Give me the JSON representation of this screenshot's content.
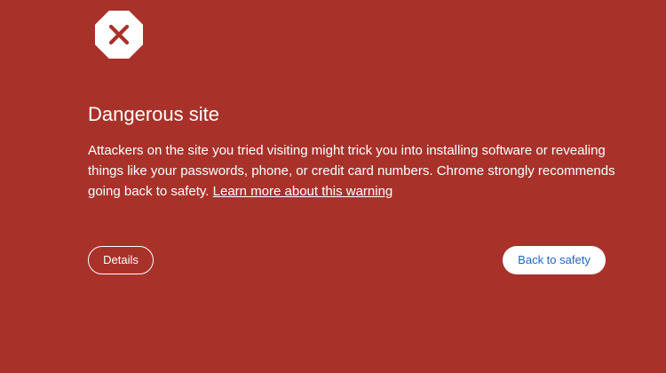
{
  "colors": {
    "background": "#a8322a",
    "text": "#ffffff",
    "primary_button_text": "#1a66c9",
    "icon_fill": "#ffffff",
    "icon_cross": "#a8322a"
  },
  "icon": {
    "name": "danger-stop-icon"
  },
  "heading": {
    "title": "Dangerous site"
  },
  "message": {
    "text": "Attackers on the site you tried visiting might trick you into installing software or revealing things like your passwords, phone, or credit card numbers. Chrome strongly recommends going back to safety.",
    "link_label": "Learn more about this warning"
  },
  "buttons": {
    "details_label": "Details",
    "back_to_safety_label": "Back to safety"
  }
}
